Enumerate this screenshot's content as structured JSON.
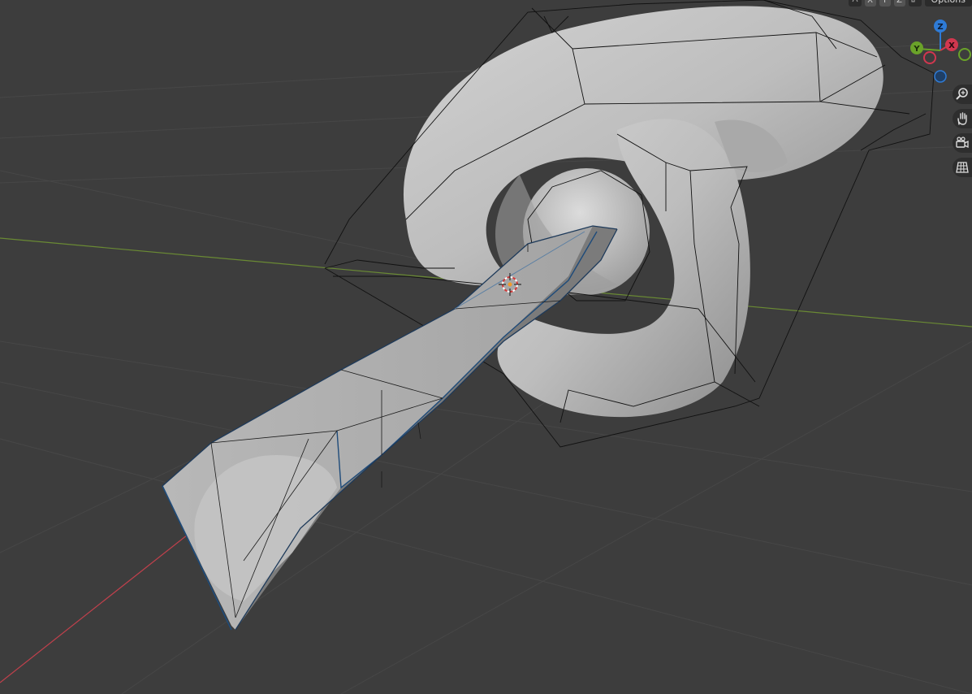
{
  "header": {
    "axis_buttons": [
      "X",
      "Y",
      "Z"
    ],
    "options_label": "Options"
  },
  "gizmo": {
    "z_label": "Z",
    "x_label": "X",
    "y_label": "Y",
    "colors": {
      "z": "#2e7bd6",
      "x": "#d1374f",
      "y": "#6aa229"
    }
  },
  "nav_tools": [
    {
      "name": "zoom",
      "icon": "magnifier-icon"
    },
    {
      "name": "pan",
      "icon": "hand-icon"
    },
    {
      "name": "camera-view",
      "icon": "camera-icon"
    },
    {
      "name": "perspective-toggle",
      "icon": "grid-icon"
    }
  ],
  "colors": {
    "background": "#3d3d3d",
    "x_axis": "#c0404c",
    "y_axis": "#6a8a34",
    "mesh_light": "#c2c2c2",
    "mesh_shadow": "#8a8a8a",
    "selection_outline": "#1e4b7a"
  }
}
